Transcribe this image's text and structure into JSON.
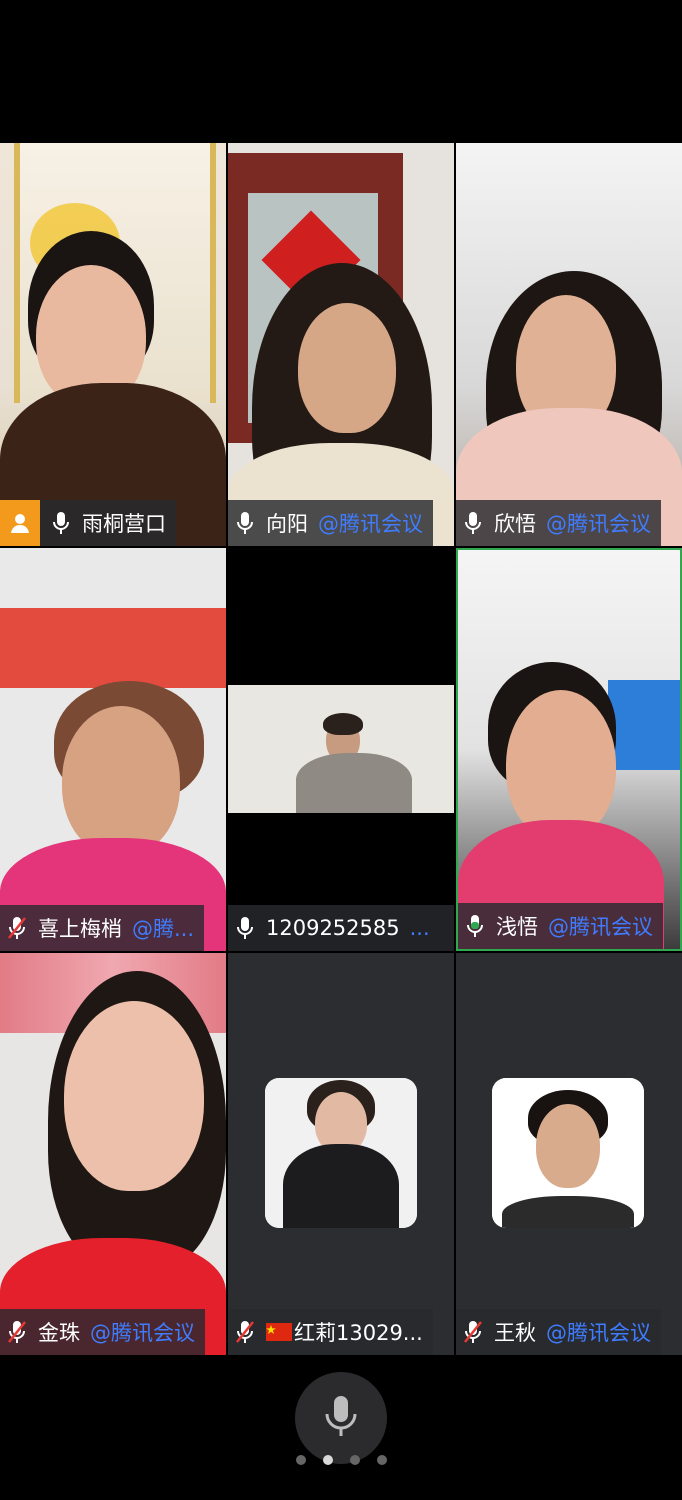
{
  "participants": [
    {
      "name": "雨桐营口",
      "org": "",
      "muted": false,
      "host": true,
      "active": false,
      "kind": "video"
    },
    {
      "name": "向阳",
      "org": "@腾讯会议",
      "muted": false,
      "host": false,
      "active": false,
      "kind": "video"
    },
    {
      "name": "欣悟",
      "org": "@腾讯会议",
      "muted": false,
      "host": false,
      "active": false,
      "kind": "video"
    },
    {
      "name": "喜上梅梢",
      "org": "@腾...",
      "muted": true,
      "host": false,
      "active": false,
      "kind": "video"
    },
    {
      "name": "1209252585",
      "org": "...",
      "muted": false,
      "host": false,
      "active": false,
      "kind": "video"
    },
    {
      "name": "浅悟",
      "org": "@腾讯会议",
      "muted": false,
      "host": false,
      "active": true,
      "kind": "video"
    },
    {
      "name": "金珠",
      "org": "@腾讯会议",
      "muted": true,
      "host": false,
      "active": false,
      "kind": "video"
    },
    {
      "name": "红莉13029...",
      "org": "",
      "muted": true,
      "host": false,
      "active": false,
      "kind": "avatar",
      "flag": "🇨🇳"
    },
    {
      "name": "王秋",
      "org": "@腾讯会议",
      "muted": true,
      "host": false,
      "active": false,
      "kind": "avatar"
    }
  ],
  "pager": {
    "count": 4,
    "active": 1
  },
  "colors": {
    "active_border": "#2fa84f",
    "org_text": "#3f7cff",
    "host_badge": "#f39a1c"
  }
}
